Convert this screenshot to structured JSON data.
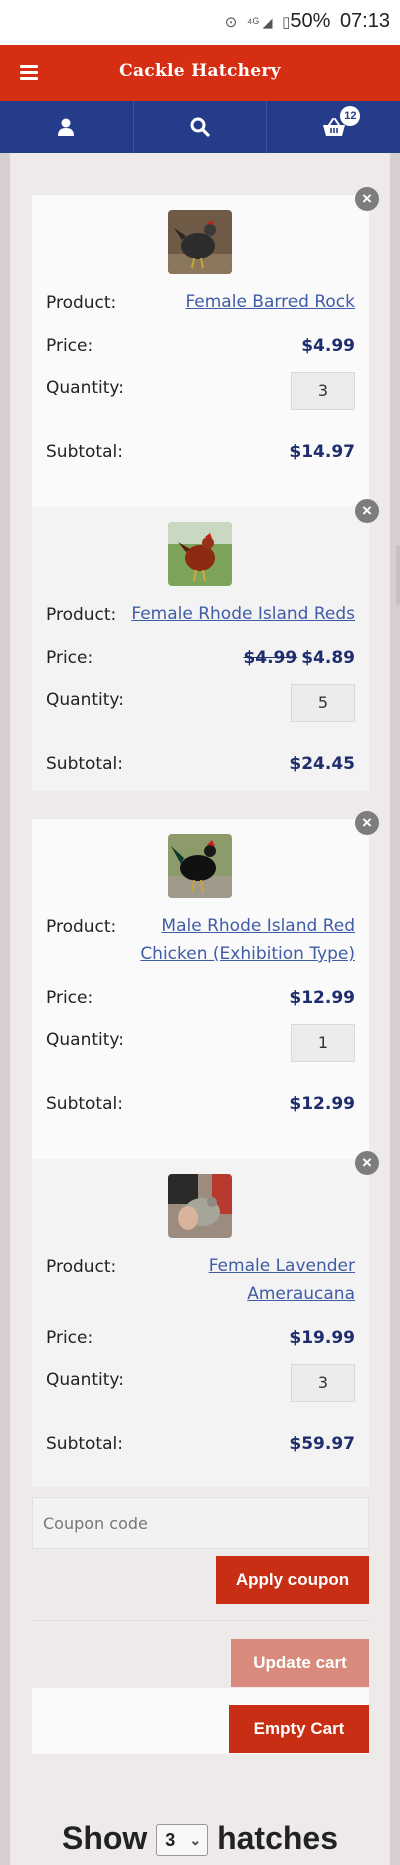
{
  "status_bar": {
    "battery": "50%",
    "time": "07:13"
  },
  "header": {
    "brand": "Cackle Hatchery"
  },
  "nav": {
    "cart_count": "12"
  },
  "labels": {
    "product": "Product:",
    "price": "Price:",
    "quantity": "Quantity:",
    "subtotal": "Subtotal:"
  },
  "cart": {
    "items": [
      {
        "name": "Female Barred Rock",
        "price": "$4.99",
        "old_price": "",
        "quantity": "3",
        "subtotal": "$14.97"
      },
      {
        "name": "Female Rhode Island Reds",
        "price": "$4.89",
        "old_price": "$4.99",
        "quantity": "5",
        "subtotal": "$24.45"
      },
      {
        "name_line1": "Male Rhode Island Red",
        "name_line2": "Chicken (Exhibition Type)",
        "price": "$12.99",
        "quantity": "1",
        "subtotal": "$12.99"
      },
      {
        "name_line1": "Female Lavender",
        "name_line2": "Ameraucana",
        "price": "$19.99",
        "quantity": "3",
        "subtotal": "$59.97"
      }
    ]
  },
  "coupon": {
    "placeholder": "Coupon code",
    "apply_label": "Apply coupon"
  },
  "actions": {
    "update_label": "Update cart",
    "empty_label": "Empty Cart"
  },
  "show_hatches": {
    "prefix": "Show",
    "selected": "3",
    "suffix": "hatches"
  },
  "colors": {
    "header_red": "#d62e13",
    "nav_blue": "#243c8a",
    "price_blue": "#1d2d6d",
    "button_red": "#c82e14"
  }
}
